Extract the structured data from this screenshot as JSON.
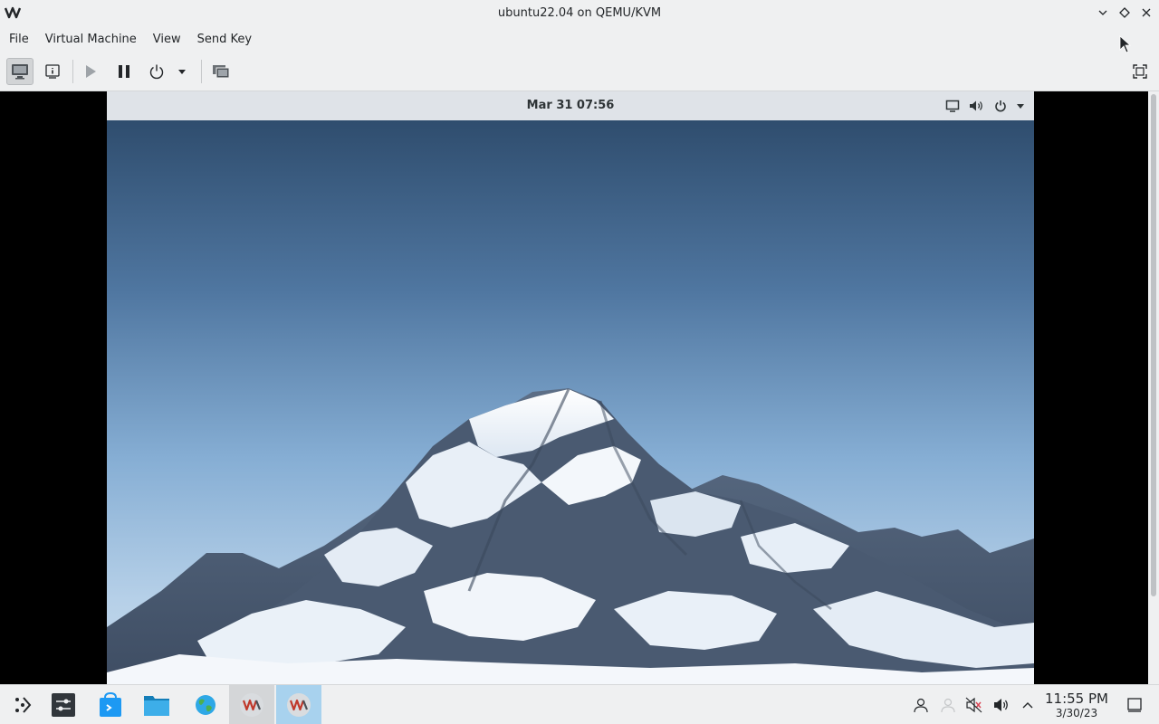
{
  "window": {
    "title": "ubuntu22.04 on QEMU/KVM",
    "logo_icon": "virt-manager-logo",
    "controls": [
      "minimize-icon",
      "maximize-icon",
      "close-icon"
    ]
  },
  "menubar": {
    "items": [
      {
        "label": "File"
      },
      {
        "label": "Virtual Machine"
      },
      {
        "label": "View"
      },
      {
        "label": "Send Key"
      }
    ]
  },
  "toolbar": {
    "buttons": [
      {
        "name": "console",
        "icon": "monitor-icon",
        "active": true
      },
      {
        "name": "details",
        "icon": "info-icon"
      },
      {
        "name": "run",
        "icon": "play-icon"
      },
      {
        "name": "pause",
        "icon": "pause-icon"
      },
      {
        "name": "shutdown",
        "icon": "power-icon"
      },
      {
        "name": "shutdown-menu",
        "icon": "dropdown-arrow-icon"
      },
      {
        "name": "snapshots",
        "icon": "snapshots-icon"
      },
      {
        "name": "fullscreen",
        "icon": "fullscreen-icon"
      }
    ]
  },
  "guest": {
    "clock": "Mar 31  07:56",
    "tray_icons": [
      "display-icon",
      "volume-icon",
      "power-icon",
      "dropdown-arrow-icon"
    ]
  },
  "taskbar": {
    "items": [
      "application-launcher-icon",
      "system-settings-icon",
      "discover-store-icon",
      "file-manager-icon",
      "web-browser-icon",
      "virt-manager-window",
      "virt-manager-window-active"
    ],
    "tray_icons": [
      "user-icon",
      "network-disconnected-icon",
      "audio-muted-icon",
      "volume-icon",
      "tray-expand-icon",
      "show-desktop-icon"
    ],
    "time": "11:55 PM",
    "date": "3/30/23"
  },
  "colors": {
    "chrome_bg": "#eff0f1",
    "guest_panel": "#dfe3e8",
    "task_focus": "#a8d2ee",
    "accent_blue": "#3daee9"
  }
}
